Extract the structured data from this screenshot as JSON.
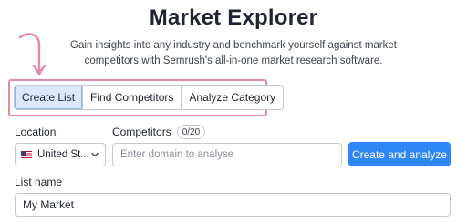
{
  "header": {
    "title": "Market Explorer",
    "subtitle": "Gain insights into any industry and benchmark yourself against market competitors with Semrush's all-in-one market research software."
  },
  "tabs": [
    {
      "label": "Create List",
      "active": true
    },
    {
      "label": "Find Competitors",
      "active": false
    },
    {
      "label": "Analyze Category",
      "active": false
    }
  ],
  "form": {
    "location_label": "Location",
    "location_value": "United St...",
    "location_flag": "us-flag-icon",
    "competitors_label": "Competitors",
    "competitors_count": "0/20",
    "domain_placeholder": "Enter domain to analyse",
    "submit_label": "Create and analyze",
    "list_name_label": "List name",
    "list_name_value": "My Market"
  },
  "colors": {
    "accent": "#2f86f6",
    "highlight": "#e58aa5",
    "active_tab": "#d9e8fb"
  }
}
